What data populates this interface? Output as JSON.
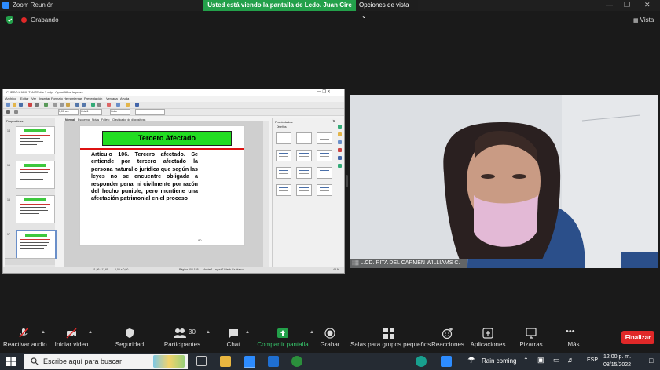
{
  "window": {
    "title": "Zoom Reunión"
  },
  "share_banner": {
    "message": "Usted está viendo la pantalla de Lcdo. Juan Cire",
    "options_label": "Opciones de vista",
    "options_caret": "⌄"
  },
  "recording": {
    "label": "Grabando"
  },
  "view_button": {
    "label": "Vista"
  },
  "impress": {
    "window_title": "CURSO HABILITANTE día 1.odp - OpenOffice Impress",
    "menu": [
      "Archivo",
      "Editar",
      "Ver",
      "Insertar",
      "Formato",
      "Herramientas",
      "Presentación",
      "Ventana",
      "Ayuda"
    ],
    "tabs": [
      "Normal",
      "Esquema",
      "Notas",
      "Folleto",
      "Clasificador de diapositivas"
    ],
    "panel_title": "Diapositivas",
    "slide_numbers": [
      "14",
      "15",
      "16",
      "17"
    ],
    "font_size": "0,00 cm",
    "color_field": "Gris 6",
    "fill_field": "Color",
    "slide": {
      "title": "Tercero Afectado",
      "body": "Artículo 106. Tercero afectado. Se entiende por tercero afectado la persona natural o jurídica que según las leyes no se encuentre obligada a responder penal ni civilmente por razón del hecho punible, pero mcntiene una afectación patrimonial en el proceso",
      "number": "80"
    },
    "properties": {
      "title": "Propiedades",
      "section": "Diseños"
    },
    "status": {
      "position": "11,86 / 11,65",
      "size": "0,00 x 0,00",
      "page": "Página 80 / 155",
      "master": "Master1-Layout7-Blank-Ex-blanco",
      "zoom": "48 %"
    }
  },
  "camera": {
    "participant": "L.CD. RITA DEL CARMEN WILLIAMS C."
  },
  "toolbar": {
    "mute": "Reactivar audio",
    "video": "Iniciar video",
    "security": "Seguridad",
    "participants": "Participantes",
    "participants_count": "30",
    "chat": "Chat",
    "share": "Compartir pantalla",
    "record": "Grabar",
    "breakout": "Salas para grupos pequeños",
    "reactions": "Reacciones",
    "apps": "Aplicaciones",
    "whiteboard": "Pizarras",
    "more": "Más",
    "end": "Finalizar"
  },
  "taskbar": {
    "search_placeholder": "Escribe aquí para buscar",
    "weather": "Rain coming",
    "language": "ESP",
    "time": "12:00 p. m.",
    "date": "08/15/2022"
  },
  "colors": {
    "zoom_blue": "#2d8cff",
    "share_green": "#23a04a",
    "end_red": "#e02828",
    "slide_title_green": "#22dd22"
  }
}
